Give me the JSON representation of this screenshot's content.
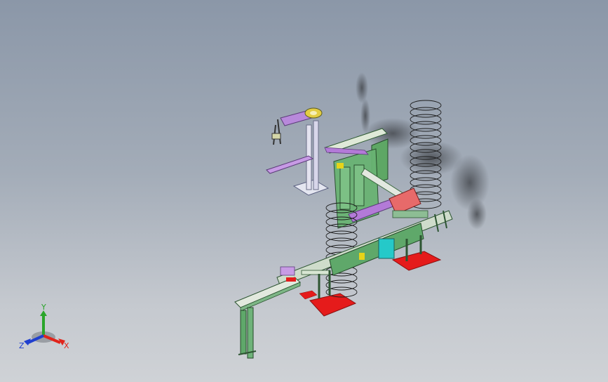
{
  "view": {
    "background_top": "#8b97a8",
    "background_bottom": "#cfd2d6"
  },
  "triad": {
    "x_label": "X",
    "y_label": "Y",
    "z_label": "Z",
    "x_color": "#e0241b",
    "y_color": "#2aa52a",
    "z_color": "#1f3fcf"
  },
  "model_colors": {
    "frame_green": "#4c9a55",
    "frame_light": "#d9e5d6",
    "bracket_purple": "#b37ad8",
    "base_pad_red": "#e51b1b",
    "spring_dark": "#222222",
    "accent_yellow": "#e6d419",
    "accent_cyan": "#25c9c9"
  }
}
